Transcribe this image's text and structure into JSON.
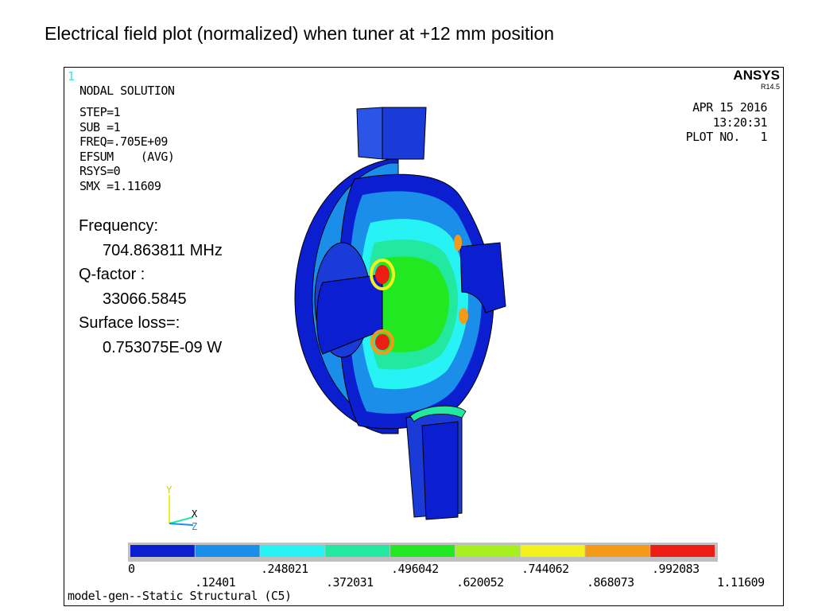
{
  "slide": {
    "title": "Electrical field plot (normalized) when tuner at +12 mm position"
  },
  "plot": {
    "window_number": "1",
    "result_type": "NODAL SOLUTION",
    "params": [
      "STEP=1",
      "SUB =1",
      "FREQ=.705E+09",
      "EFSUM    (AVG)",
      "RSYS=0",
      "SMX =1.11609"
    ],
    "brand": "ANSYS",
    "version": "R14.5",
    "date": "APR 15 2016",
    "time": "13:20:31",
    "plot_no": "PLOT NO.   1",
    "footer": "model-gen--Static Structural (C5)",
    "triad": {
      "y": "Y",
      "x": "X",
      "z": "Z"
    }
  },
  "annotation": {
    "freq_label": "Frequency:",
    "freq_value": "704.863811 MHz",
    "q_label": "Q-factor :",
    "q_value": "33066.5845",
    "loss_label": "Surface loss=:",
    "loss_value": "0.753075E-09 W"
  },
  "legend": {
    "colors": [
      "#0b1ed0",
      "#1a8ee8",
      "#27f3f5",
      "#22e8a0",
      "#22e822",
      "#a6f01f",
      "#f4f21e",
      "#f49a18",
      "#ee1d14"
    ],
    "labels_top": [
      "0",
      ".248021",
      ".496042",
      ".744062",
      ".992083"
    ],
    "labels_bottom": [
      ".12401",
      ".372031",
      ".620052",
      ".868073",
      "1.11609"
    ]
  }
}
